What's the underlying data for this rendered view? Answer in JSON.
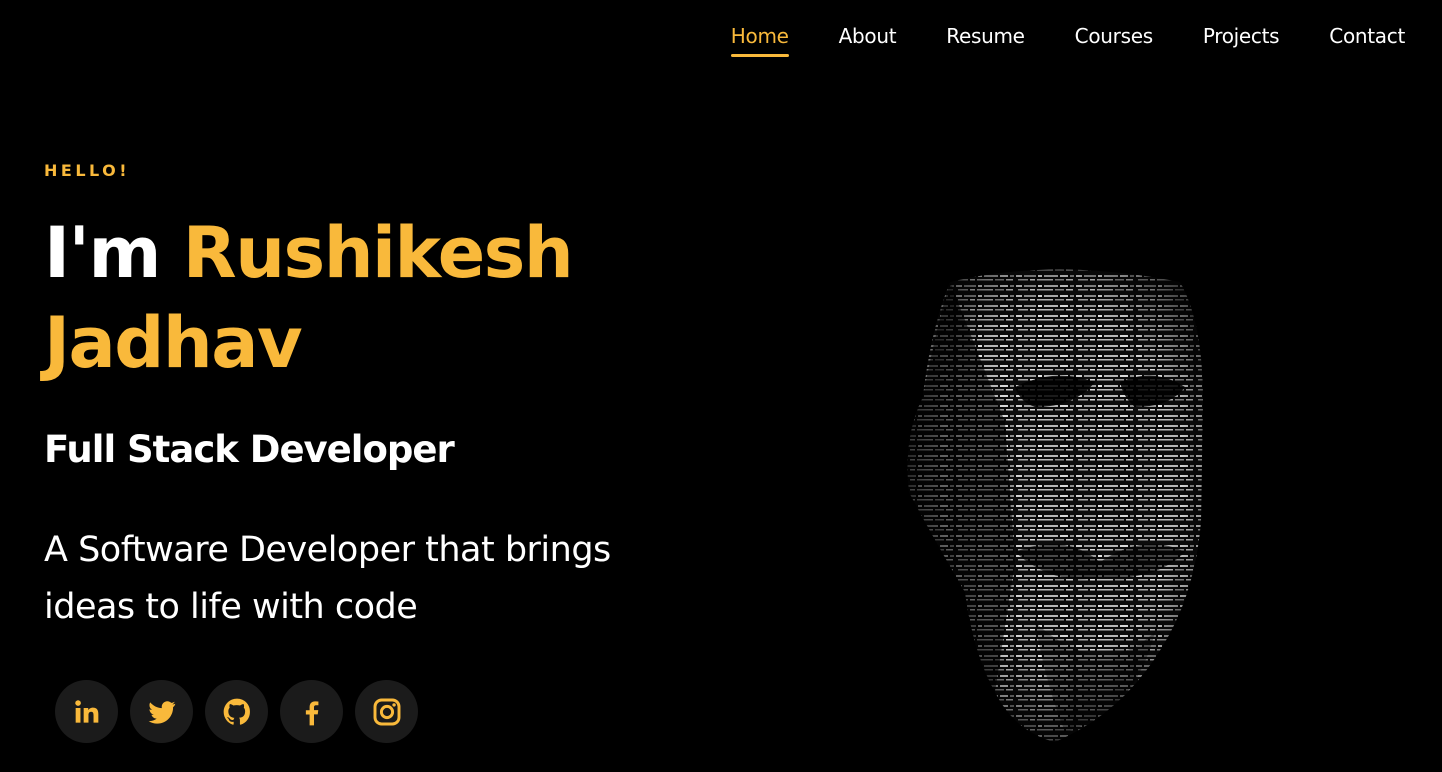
{
  "nav": {
    "items": [
      {
        "label": "Home",
        "active": true
      },
      {
        "label": "About",
        "active": false
      },
      {
        "label": "Resume",
        "active": false
      },
      {
        "label": "Courses",
        "active": false
      },
      {
        "label": "Projects",
        "active": false
      },
      {
        "label": "Contact",
        "active": false
      }
    ]
  },
  "hero": {
    "greeting": "HELLO!",
    "prefix": "I'm",
    "first_name": "Rushikesh",
    "last_name": "Jadhav",
    "role": "Full Stack Developer",
    "tagline": "A Software Developer that brings ideas to life with code"
  },
  "social": {
    "items": [
      {
        "icon": "linkedin-icon"
      },
      {
        "icon": "twitter-icon"
      },
      {
        "icon": "github-icon"
      },
      {
        "icon": "facebook-icon"
      },
      {
        "icon": "instagram-icon"
      }
    ]
  },
  "colors": {
    "accent": "#f9b93b",
    "background": "#000000",
    "text": "#ffffff",
    "social_bg": "#1b1b1b"
  }
}
